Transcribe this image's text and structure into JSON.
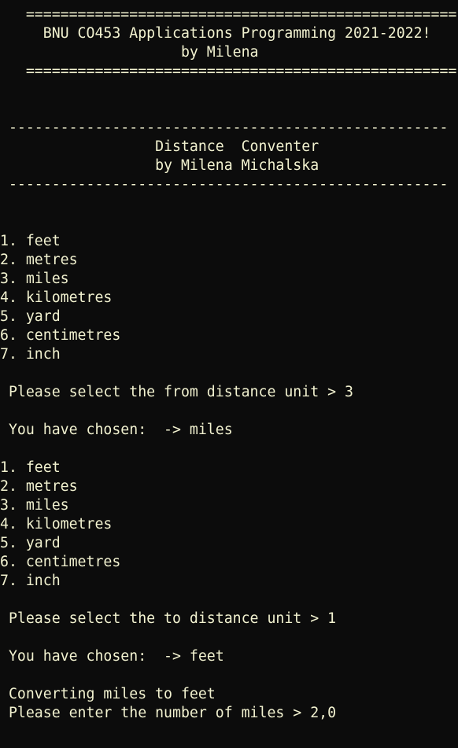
{
  "console": {
    "lines": [
      "   ==================================================",
      "     BNU CO453 Applications Programming 2021-2022!",
      "                     by Milena",
      "   ==================================================",
      "",
      "",
      " ---------------------------------------------------",
      "                  Distance  Conventer",
      "                  by Milena Michalska",
      " ---------------------------------------------------",
      "",
      "",
      "1. feet",
      "2. metres",
      "3. miles",
      "4. kilometres",
      "5. yard",
      "6. centimetres",
      "7. inch",
      "",
      " Please select the from distance unit > 3",
      "",
      " You have chosen:  -> miles",
      "",
      "1. feet",
      "2. metres",
      "3. miles",
      "4. kilometres",
      "5. yard",
      "6. centimetres",
      "7. inch",
      "",
      " Please select the to distance unit > 1",
      "",
      " You have chosen:  -> feet",
      "",
      " Converting miles to feet",
      " Please enter the number of miles > 2,0"
    ]
  }
}
